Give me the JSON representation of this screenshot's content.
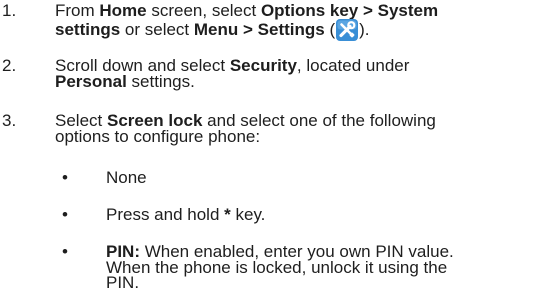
{
  "steps": [
    {
      "number": "1.",
      "line1": {
        "t1": "From ",
        "b1": "Home",
        "t2": " screen, select ",
        "b2": "Options key > System"
      },
      "line2": {
        "b1": "settings",
        "t1": " or select ",
        "b2": "Menu > Settings",
        "t2": " (",
        "t3": ")."
      }
    },
    {
      "number": "2.",
      "line1": {
        "t1": "Scroll down and select ",
        "b1": "Security",
        "t2": ", located under"
      },
      "line2": {
        "b1": "Personal",
        "t1": " settings."
      }
    },
    {
      "number": "3.",
      "line1": {
        "t1": "Select ",
        "b1": "Screen lock",
        "t2": " and select one of the following"
      },
      "line2": {
        "t1": "options to configure phone:"
      }
    }
  ],
  "bullets": [
    {
      "marker": "•",
      "text": "None"
    },
    {
      "marker": "•",
      "text_pre": "Press and hold ",
      "text_bold": "*",
      "text_post": " key."
    },
    {
      "marker": "•",
      "bold": "PIN:",
      "line1": " When enabled, enter you own PIN value.",
      "line2": "When the phone is locked, unlock it using the",
      "line3": "PIN."
    }
  ],
  "icons": {
    "settings_icon": "tools-icon",
    "settings_icon_color": "#3a8fd6"
  }
}
